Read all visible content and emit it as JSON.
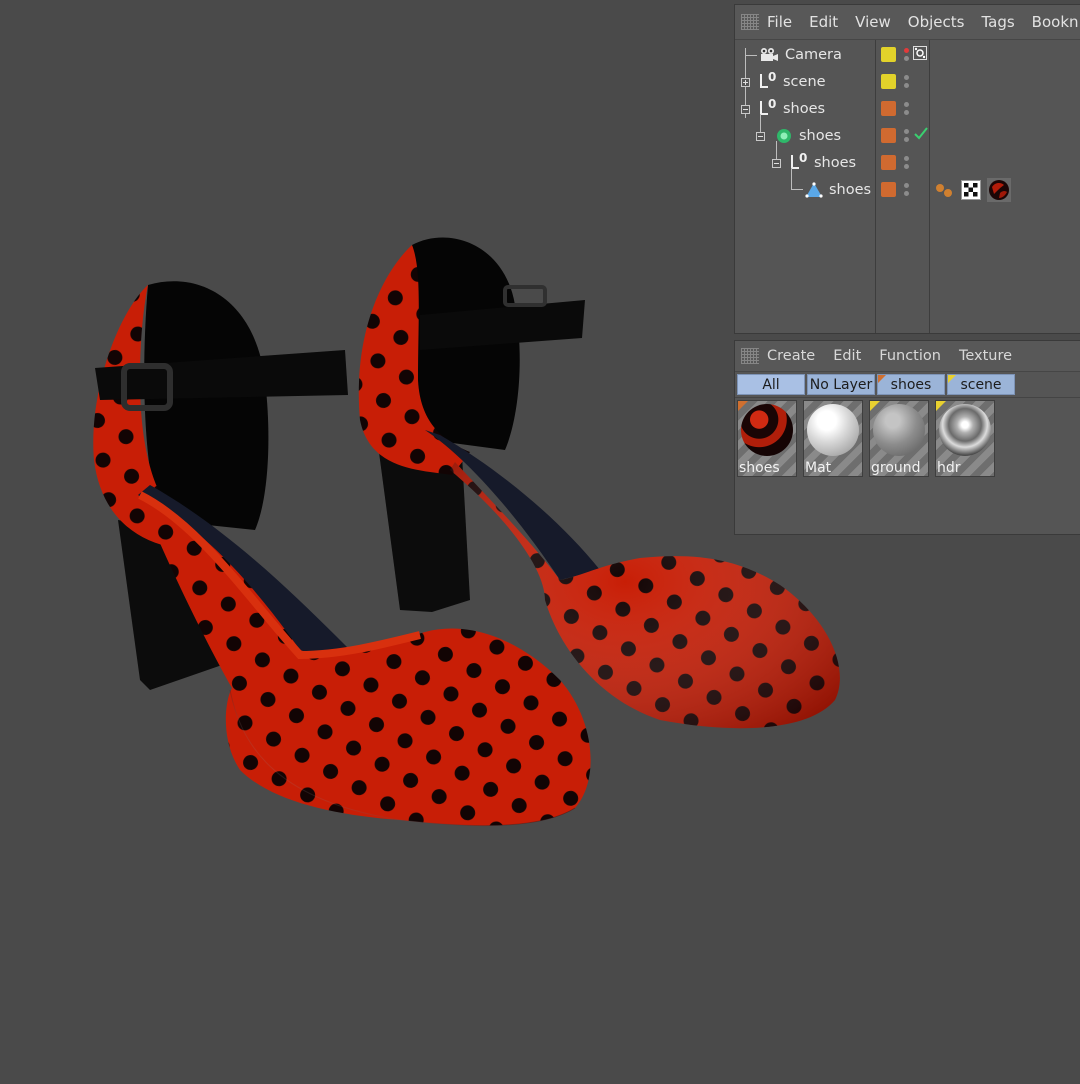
{
  "object_manager": {
    "menu": [
      "File",
      "Edit",
      "View",
      "Objects",
      "Tags",
      "Bookn"
    ],
    "objects": [
      {
        "name": "Camera",
        "icon": "camera-icon",
        "color": "#e2d22a"
      },
      {
        "name": "scene",
        "icon": "null-object-icon",
        "color": "#e2d22a"
      },
      {
        "name": "shoes",
        "icon": "null-object-icon",
        "color": "#d06a30"
      },
      {
        "name": "shoes",
        "icon": "subdivision-icon",
        "color": "#d06a30"
      },
      {
        "name": "shoes",
        "icon": "null-object-icon",
        "color": "#d06a30"
      },
      {
        "name": "shoes",
        "icon": "polygon-object-icon",
        "color": "#d06a30"
      }
    ]
  },
  "material_manager": {
    "menu": [
      "Create",
      "Edit",
      "Function",
      "Texture"
    ],
    "filters": [
      "All",
      "No Layer",
      "shoes",
      "scene"
    ],
    "materials": [
      {
        "name": "shoes"
      },
      {
        "name": "Mat"
      },
      {
        "name": "ground"
      },
      {
        "name": "hdr"
      }
    ]
  }
}
